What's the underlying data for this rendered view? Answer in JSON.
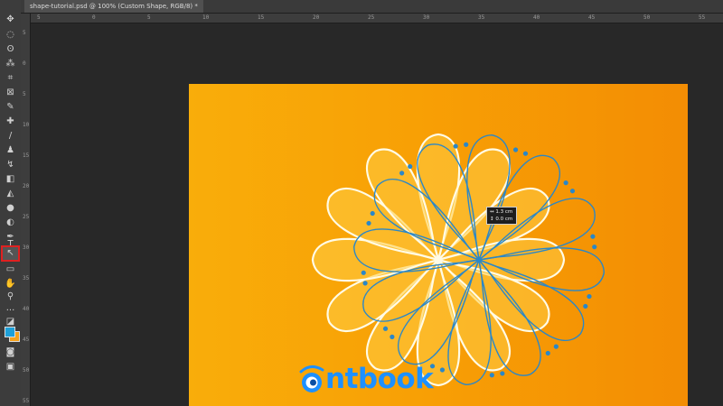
{
  "document": {
    "tab_title": "shape-tutorial.psd @ 100% (Custom Shape, RGB/8) *"
  },
  "ruler": {
    "h_labels": [
      "5",
      "0",
      "5",
      "10",
      "15",
      "20",
      "25",
      "30",
      "35",
      "40",
      "45",
      "50",
      "55"
    ],
    "v_labels": [
      "5",
      "0",
      "5",
      "10",
      "15",
      "20",
      "25",
      "30",
      "35",
      "40",
      "45",
      "50",
      "55"
    ]
  },
  "tools": [
    {
      "name": "move-tool",
      "glyph": "✥"
    },
    {
      "name": "marquee-tool",
      "glyph": "◌"
    },
    {
      "name": "lasso-tool",
      "glyph": "ʘ"
    },
    {
      "name": "magic-wand-tool",
      "glyph": "⁂"
    },
    {
      "name": "crop-tool",
      "glyph": "⌗"
    },
    {
      "name": "frame-tool",
      "glyph": "⊠"
    },
    {
      "name": "eyedropper-tool",
      "glyph": "✎"
    },
    {
      "name": "healing-brush-tool",
      "glyph": "✚"
    },
    {
      "name": "brush-tool",
      "glyph": "/"
    },
    {
      "name": "clone-stamp-tool",
      "glyph": "♟"
    },
    {
      "name": "history-brush-tool",
      "glyph": "↯"
    },
    {
      "name": "eraser-tool",
      "glyph": "◧"
    },
    {
      "name": "paint-bucket-tool",
      "glyph": "◭"
    },
    {
      "name": "blur-tool",
      "glyph": "●"
    },
    {
      "name": "dodge-tool",
      "glyph": "◐"
    },
    {
      "name": "pen-tool",
      "glyph": "✒"
    },
    {
      "name": "type-tool",
      "glyph": "T"
    },
    {
      "name": "direct-selection-tool",
      "glyph": "↖"
    },
    {
      "name": "custom-shape-tool",
      "glyph": "▭"
    },
    {
      "name": "hand-tool",
      "glyph": "✋"
    },
    {
      "name": "zoom-tool",
      "glyph": "⚲"
    },
    {
      "name": "more-tools",
      "glyph": "···"
    },
    {
      "name": "default-colors",
      "glyph": "◪"
    },
    {
      "name": "color-swatches",
      "glyph": ""
    },
    {
      "name": "quick-mask",
      "glyph": "◙"
    },
    {
      "name": "screen-mode",
      "glyph": "▣"
    }
  ],
  "active_tool": "direct-selection-tool",
  "colors": {
    "foreground": "#1ea0d8",
    "background": "#f7a21b",
    "path": "#2a87c8",
    "outline": "#fffbe6"
  },
  "transform_readout": {
    "line1": "↔ 1.3 cm",
    "line2": "↕ 0.0 cm"
  },
  "logo": {
    "text": "ntbook"
  }
}
